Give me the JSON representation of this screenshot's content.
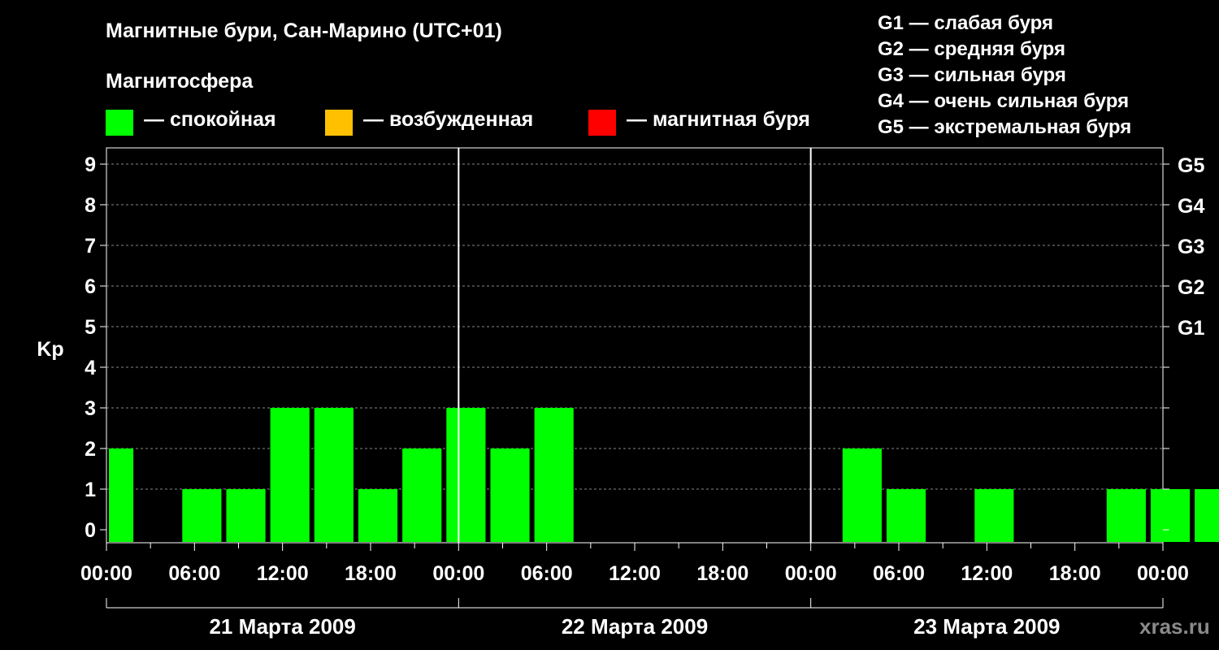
{
  "title": "Магнитные бури, Сан-Марино (UTC+01)",
  "subtitle": "Магнитосфера",
  "legend": [
    {
      "label": "— спокойная",
      "color": "#00ff00"
    },
    {
      "label": "— возбужденная",
      "color": "#ffc000"
    },
    {
      "label": "— магнитная буря",
      "color": "#ff0000"
    }
  ],
  "g_legend": [
    "G1 — слабая буря",
    "G2 — средняя буря",
    "G3 — сильная буря",
    "G4 — очень сильная буря",
    "G5 — экстремальная буря"
  ],
  "watermark": "xras.ru",
  "chart_data": {
    "type": "bar",
    "ylabel": "Kp",
    "ylim": [
      0,
      9
    ],
    "y_ticks": [
      "0",
      "1",
      "2",
      "3",
      "4",
      "5",
      "6",
      "7",
      "8",
      "9"
    ],
    "g_ticks": [
      {
        "kp": 5,
        "label": "G1"
      },
      {
        "kp": 6,
        "label": "G2"
      },
      {
        "kp": 7,
        "label": "G3"
      },
      {
        "kp": 8,
        "label": "G4"
      },
      {
        "kp": 9,
        "label": "G5"
      }
    ],
    "x_tick_labels": [
      "00:00",
      "06:00",
      "12:00",
      "18:00",
      "00:00",
      "06:00",
      "12:00",
      "18:00",
      "00:00",
      "06:00",
      "12:00",
      "18:00",
      "00:00"
    ],
    "days": [
      "21 Марта 2009",
      "22 Марта 2009",
      "23 Марта 2009"
    ],
    "interval_hours": 3,
    "x_start_hour": -1,
    "values": [
      2,
      0,
      1,
      1,
      3,
      3,
      1,
      2,
      3,
      2,
      3,
      0,
      0,
      0,
      0,
      0,
      0,
      2,
      1,
      0,
      1,
      0,
      0,
      1,
      1,
      1
    ],
    "grid": true,
    "colors": {
      "quiet": "#00ff00",
      "active": "#ffc000",
      "storm": "#ff0000"
    }
  }
}
